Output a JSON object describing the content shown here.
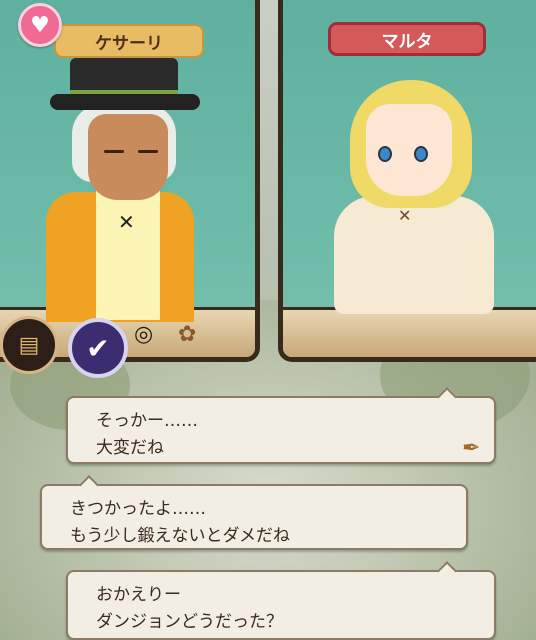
{
  "speakers": {
    "left_name": "ケサーリ",
    "right_name": "マルタ"
  },
  "icons": {
    "heart": "heart-icon",
    "book": "book-icon",
    "check": "check-icon",
    "ring": "ring-icon",
    "wheat": "wheat-icon",
    "quill": "quill-icon"
  },
  "dialogue": [
    {
      "speaker": "right",
      "line1": "そっかー……",
      "line2": "大変だね"
    },
    {
      "speaker": "left",
      "line1": "きつかったよ……",
      "line2": "もう少し鍛えないとダメだね"
    },
    {
      "speaker": "right",
      "line1": "おかえりー",
      "line2": "ダンジョンどうだった？"
    }
  ],
  "colors": {
    "panel_bg": "#69b7a5",
    "frame": "#3a2a1c",
    "left_nameplate": "#e8bc63",
    "right_nameplate": "#d45a5a",
    "heart": "#f06a94"
  }
}
